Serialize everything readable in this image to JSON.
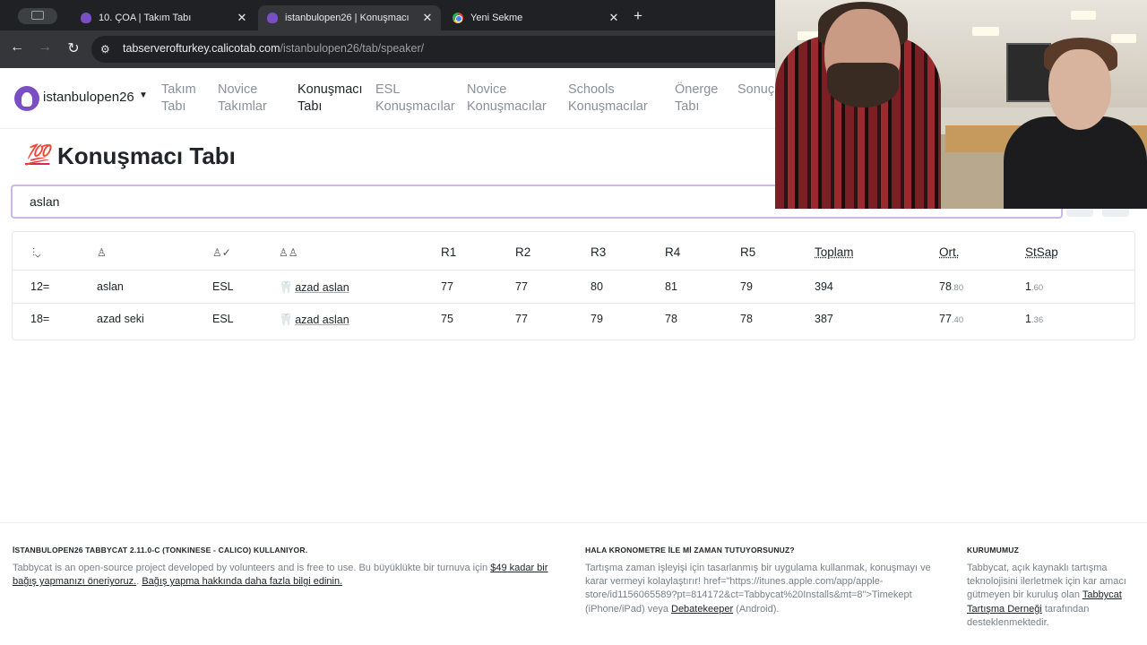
{
  "browser": {
    "tabs": [
      {
        "title": "10. ÇOA | Takım Tabı",
        "icon": "tabbycat-favicon-icon",
        "active": false
      },
      {
        "title": "istanbulopen26 | Konuşmacı",
        "icon": "tabbycat-favicon-icon",
        "active": true
      },
      {
        "title": "Yeni Sekme",
        "icon": "chrome-favicon-icon",
        "active": false
      }
    ],
    "url_host": "tabserverofturkey.calicotab.com",
    "url_path": "/istanbulopen26/tab/speaker/"
  },
  "nav": {
    "brand": "istanbulopen26",
    "links": [
      {
        "line1": "Takım",
        "line2": "Tabı",
        "active": false
      },
      {
        "line1": "Novice",
        "line2": "Takımlar",
        "active": false
      },
      {
        "line1": "Konuşmacı",
        "line2": "Tabı",
        "active": true
      },
      {
        "line1": "ESL",
        "line2": "Konuşmacılar",
        "active": false
      },
      {
        "line1": "Novice",
        "line2": "Konuşmacılar",
        "active": false
      },
      {
        "line1": "Schools",
        "line2": "Konuşmacılar",
        "active": false
      },
      {
        "line1": "Önerge",
        "line2": "Tabı",
        "active": false
      },
      {
        "line1": "Sonuç",
        "line2": "",
        "active": false
      }
    ]
  },
  "page": {
    "emoji": "💯",
    "title": "Konuşmacı Tabı"
  },
  "search": {
    "value": "aslan"
  },
  "table": {
    "headers": [
      "R1",
      "R2",
      "R3",
      "R4",
      "R5",
      "Toplam",
      "Ort.",
      "StSap"
    ],
    "rows": [
      {
        "rank": "12=",
        "name": "aslan",
        "category": "ESL",
        "team": "azad aslan",
        "team_emoji": "🦷",
        "r1": "77",
        "r2": "77",
        "r3": "80",
        "r4": "81",
        "r5": "79",
        "total": "394",
        "avg_int": "78",
        "avg_dec": ".80",
        "sd_int": "1",
        "sd_dec": ".60"
      },
      {
        "rank": "18=",
        "name": "azad seki",
        "category": "ESL",
        "team": "azad aslan",
        "team_emoji": "🦷",
        "r1": "75",
        "r2": "77",
        "r3": "79",
        "r4": "78",
        "r5": "78",
        "total": "387",
        "avg_int": "77",
        "avg_dec": ".40",
        "sd_int": "1",
        "sd_dec": ".36"
      }
    ]
  },
  "footer": {
    "col1_head": "İSTANBULOPEN26 TABBYCAT 2.11.0-C (TONKINESE - CALICO) KULLANIYOR.",
    "col1_text_a": "Tabbycat is an open-source project developed by volunteers and is free to use. Bu büyüklükte bir turnuva için ",
    "col1_link_a": "$49 kadar bir bağış yapmanızı öneriyoruz.",
    "col1_text_b": ". ",
    "col1_link_b": "Bağış yapma hakkında daha fazla bilgi edinin.",
    "col2_head": "HALA KRONOMETRE İLE Mİ ZAMAN TUTUYORSUNUZ?",
    "col2_text_a": "Tartışma zaman işleyişi için tasarlanmış bir uygulama kullanmak, konuşmayı ve karar vermeyi kolaylaştırır! href=\"https://itunes.apple.com/app/apple-store/id1156065589?pt=814172&ct=Tabbycat%20Installs&mt=8\">Timekept (iPhone/iPad) veya ",
    "col2_link": "Debatekeeper",
    "col2_text_b": " (Android).",
    "col3_head": "KURUMUMUZ",
    "col3_text_a": "Tabbycat, açık kaynaklı tartışma teknolojisini ilerletmek için kar amacı gütmeyen bir kuruluş olan ",
    "col3_link": "Tabbycat Tartışma Derneği",
    "col3_text_b": " tarafından desteklenmektedir."
  }
}
